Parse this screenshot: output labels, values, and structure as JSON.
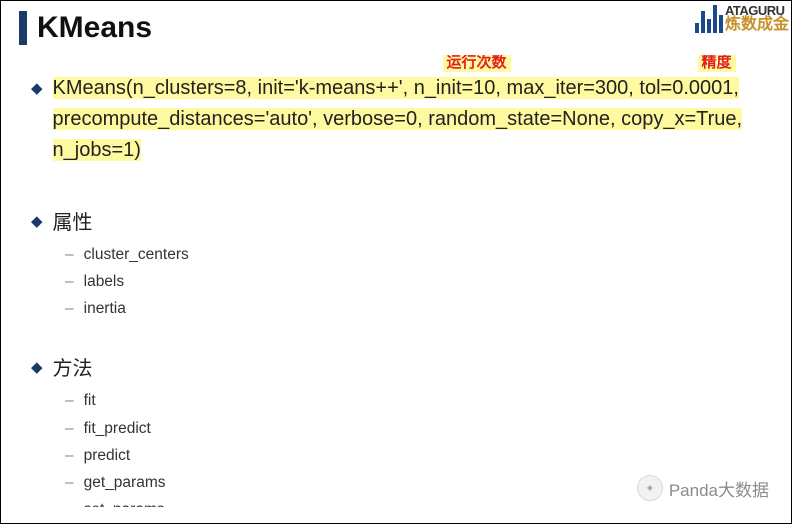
{
  "title": "KMeans",
  "logo": {
    "top": "ATAGURU",
    "bottom": "炼数成金"
  },
  "signature": "KMeans(n_clusters=8, init='k-means++', n_init=10, max_iter=300, tol=0.0001, precompute_distances='auto', verbose=0, random_state=None, copy_x=True, n_jobs=1)",
  "annotations": {
    "runs": "运行次数",
    "precision": "精度"
  },
  "attributes": {
    "heading": "属性",
    "items": [
      "cluster_centers",
      "labels",
      "inertia"
    ]
  },
  "methods": {
    "heading": "方法",
    "items": [
      "fit",
      "fit_predict",
      "predict",
      "get_params",
      "set_params"
    ]
  },
  "watermark": "Panda大数据"
}
